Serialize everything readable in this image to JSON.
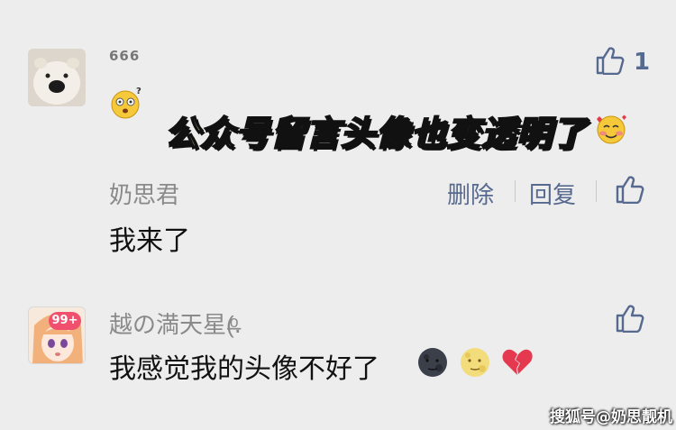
{
  "comments": [
    {
      "username": "666",
      "like_count": "1",
      "overlay_text": "公众号留言头像也变透明了"
    },
    {
      "username": "奶思君",
      "content": "我来了",
      "delete_label": "删除",
      "reply_label": "回复"
    },
    {
      "username": "越の満天星(̶̶ͦ.",
      "content": "我感觉我的头像不好了",
      "avatar_badge": "99+"
    }
  ],
  "watermark": "搜狐号@奶思靓机",
  "colors": {
    "background": "#ededed",
    "action_blue": "#56698f",
    "badge_pink": "#f0506e"
  },
  "icons": [
    "thumbs-up-icon",
    "dizzy-face-emoji",
    "smiling-hearts-emoji",
    "new-moon-face-emoji",
    "full-moon-face-emoji",
    "broken-heart-emoji"
  ]
}
